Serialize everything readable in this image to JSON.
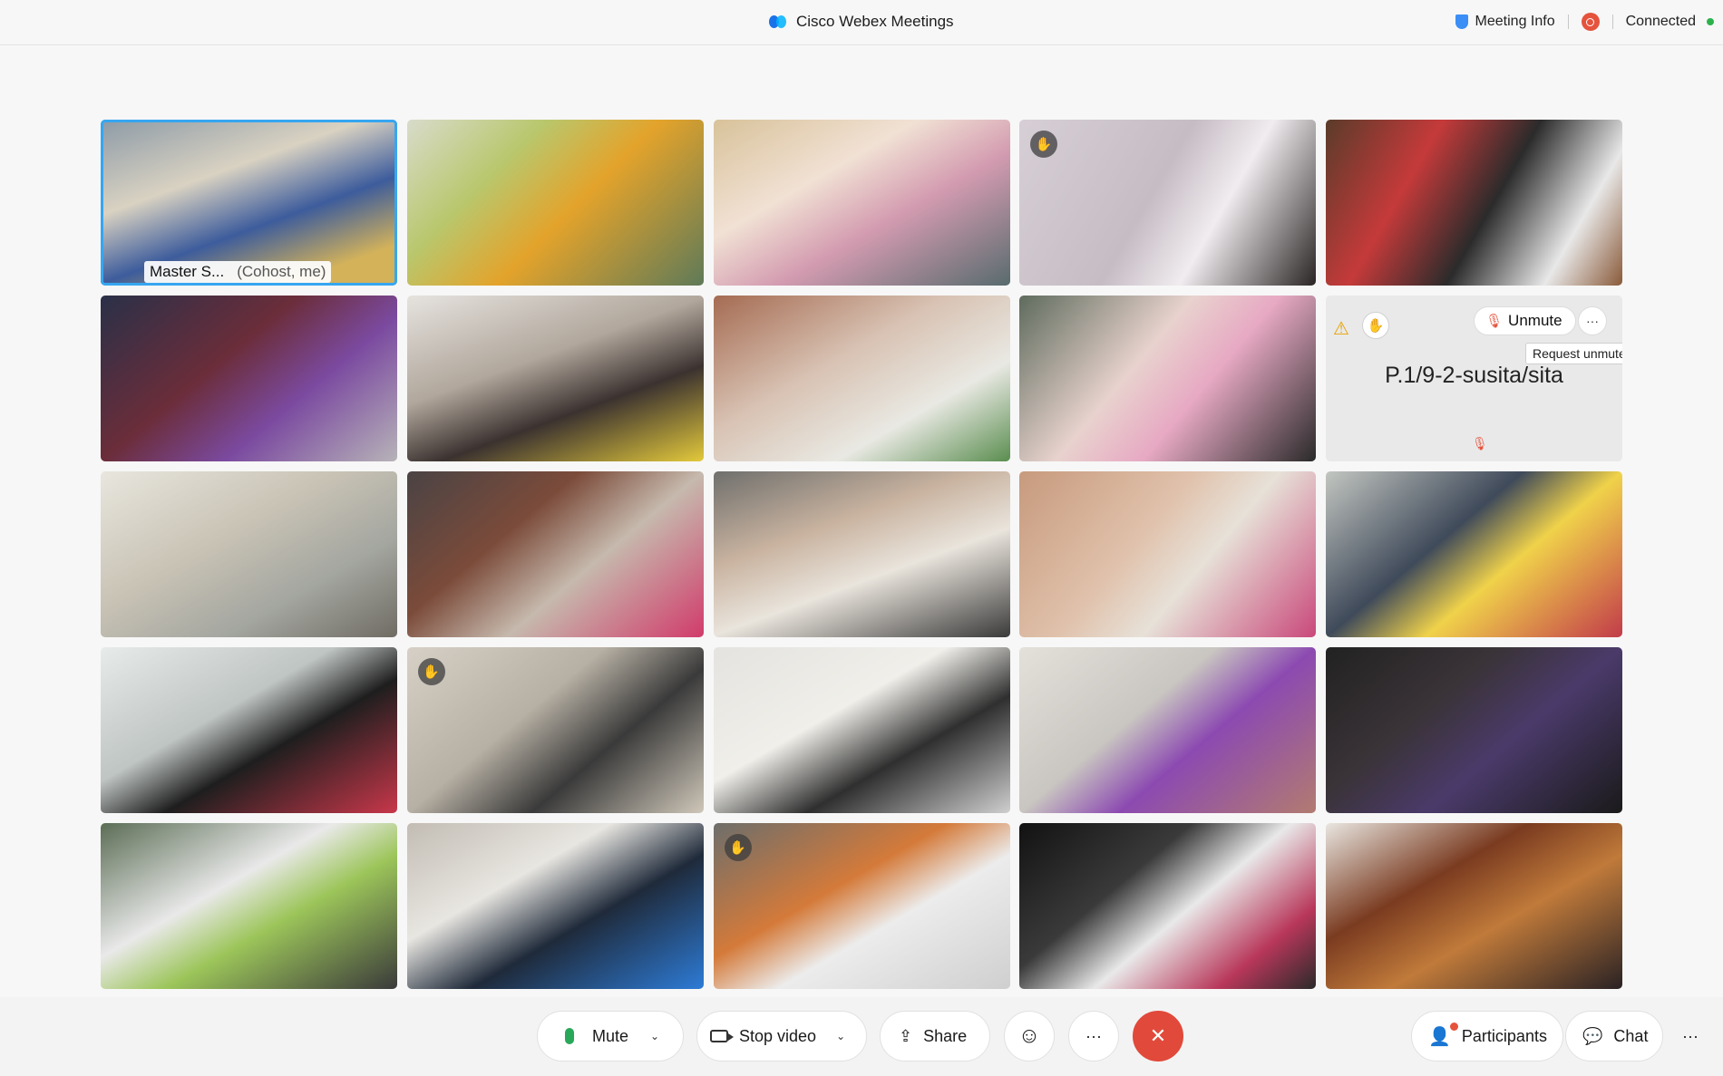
{
  "app": {
    "title": "Cisco Webex Meetings"
  },
  "header": {
    "meeting_info": "Meeting Info",
    "status": "Connected"
  },
  "self": {
    "name": "Master S...",
    "role": "(Cohost, me)"
  },
  "muted_tile": {
    "name": "P.1/9-2-susita/sita",
    "unmute_label": "Unmute",
    "more_label": "···",
    "tooltip": "Request unmute"
  },
  "controls": {
    "mute": "Mute",
    "stop_video": "Stop video",
    "share": "Share",
    "reactions_icon": "☺",
    "more": "···",
    "end": "✕",
    "participants": "Participants",
    "chat": "Chat",
    "overflow": "···"
  },
  "colors": {
    "accent": "#36a6f0",
    "end_call": "#e1493a",
    "mic_on": "#29a85a",
    "connected": "#2bb24c"
  },
  "tiles": [
    {
      "bg": "linear-gradient(160deg,#8c9aa6 0%,#d9d2c2 35%,#3d5c9c 60%,#d3b25a 85%)"
    },
    {
      "bg": "linear-gradient(135deg,#d8dccb 0%,#b9c76d 30%,#e3a32b 55%,#5f7a58 100%)"
    },
    {
      "bg": "linear-gradient(150deg,#d8c29a 0%,#f1e1d4 35%,#d39bb0 60%,#586b6e 100%)"
    },
    {
      "bg": "linear-gradient(120deg,#d7cfd6 0%,#c6bcc4 45%,#f0ecef 65%,#2a2524 100%)",
      "hand": true
    },
    {
      "bg": "linear-gradient(120deg,#5a3b2a 0%,#c53a3a 30%,#2b2b2b 55%,#e8e8e8 80%,#8a5a3a 100%)"
    },
    {
      "bg": "linear-gradient(140deg,#2a3048 0%,#6b2d3a 40%,#7b4aa0 65%,#b7b3b8 100%)"
    },
    {
      "bg": "linear-gradient(160deg,#e6e3df 0%,#b1a79c 40%,#3b3230 65%,#e3c93b 100%)"
    },
    {
      "bg": "linear-gradient(150deg,#a56b52 0%,#d8c2b3 40%,#e9e9e3 70%,#5a8d4f 100%)"
    },
    {
      "bg": "linear-gradient(130deg,#5e6b5c 0%,#e8d2ce 40%,#e7a9c3 60%,#2a2a2a 100%)"
    },
    {
      "blank": true
    },
    {
      "bg": "linear-gradient(150deg,#e8e6de 0%,#c9c3b5 40%,#a4a6a0 70%,#6f6c63 100%)"
    },
    {
      "bg": "linear-gradient(140deg,#4a4344 0%,#7b4b3a 35%,#c6b9ad 60%,#d13b6b 100%)"
    },
    {
      "bg": "linear-gradient(160deg,#6f6f6c 0%,#c9b3a0 35%,#e9e4dc 60%,#3a3a3a 100%)"
    },
    {
      "bg": "linear-gradient(130deg,#c79a7d 0%,#e0c1ab 40%,#e7e1d8 60%,#c9487a 100%)"
    },
    {
      "bg": "linear-gradient(140deg,#c3c6c1 0%,#3f4a5a 40%,#f0d24a 60%,#c23b4a 100%)"
    },
    {
      "bg": "linear-gradient(150deg,#e7ebea 0%,#bfc5c2 40%,#1e1e1e 60%,#c8374a 100%)"
    },
    {
      "bg": "linear-gradient(140deg,#d6d0c6 0%,#b7b0a4 40%,#3a3a3a 65%,#cfc7b9 100%)",
      "hand": true
    },
    {
      "bg": "linear-gradient(150deg,#e4e3df 0%,#f0efea 40%,#2f2f2f 65%,#cfcfcf 100%)"
    },
    {
      "bg": "linear-gradient(140deg,#e4e0da 0%,#c9c6c1 40%,#8c4ab1 60%,#b27b70 100%)"
    },
    {
      "bg": "linear-gradient(140deg,#222222 0%,#3a3337 35%,#4a3a6a 60%,#1a1a1a 100%)"
    },
    {
      "bg": "linear-gradient(150deg,#5b6d55 0%,#e9e9e9 40%,#9cc55a 60%,#3a3a3a 100%)"
    },
    {
      "bg": "linear-gradient(150deg,#c2bcb3 0%,#e8e6e1 35%,#1f2a3a 60%,#2d7bd6 100%)"
    },
    {
      "bg": "linear-gradient(150deg,#6d6e6b 0%,#d47a3a 40%,#ececec 60%,#cfcfcf 100%)",
      "hand": true
    },
    {
      "bg": "linear-gradient(140deg,#121212 0%,#3a3a3a 35%,#e9e9e9 55%,#b8375a 80%,#2a2a2a 100%)"
    },
    {
      "bg": "linear-gradient(150deg,#e9e6e1 0%,#7a3b20 35%,#c07a3a 60%,#2a2224 100%)"
    }
  ]
}
